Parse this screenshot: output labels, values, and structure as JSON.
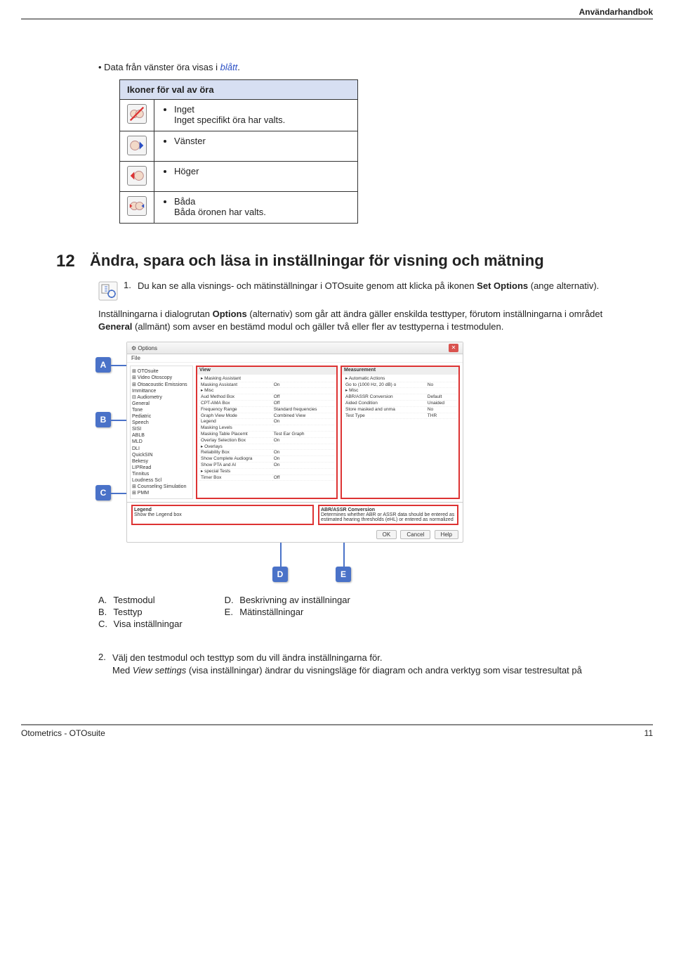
{
  "header": {
    "doc_label": "Användarhandbok"
  },
  "footer": {
    "left": "Otometrics - OTOsuite",
    "page": "11"
  },
  "intro_text_prefix": "Data från vänster öra visas i ",
  "intro_text_blue": "blått",
  "intro_text_suffix": ".",
  "ear_table": {
    "header": "Ikoner för val av öra",
    "rows": [
      {
        "icon": "none",
        "title": "Inget",
        "desc": "Inget specifikt öra har valts."
      },
      {
        "icon": "left",
        "title": "Vänster",
        "desc": ""
      },
      {
        "icon": "right",
        "title": "Höger",
        "desc": ""
      },
      {
        "icon": "both",
        "title": "Båda",
        "desc": "Båda öronen har valts."
      }
    ]
  },
  "section": {
    "num": "12",
    "title": "Ändra, spara och läsa in inställningar för visning och mätning"
  },
  "step1": {
    "num": "1.",
    "text_a": "Du kan se alla visnings- och mätinställningar i OTOsuite genom att klicka på ikonen ",
    "bold": "Set Options",
    "text_b": " (ange alternativ)."
  },
  "para2_a": "Inställningarna i dialogrutan ",
  "para2_bold1": "Options",
  "para2_b": " (alternativ) som går att ändra gäller enskilda testtyper, förutom inställningarna i området ",
  "para2_bold2": "General",
  "para2_c": " (allmänt) som avser en bestämd modul och gäller två eller fler av testtyperna i testmodulen.",
  "screenshot": {
    "title": "Options",
    "file_menu": "File",
    "tree": [
      "⊞ OTOsuite",
      "⊞ Video Otoscopy",
      "⊞ Otoacoustic Emissions",
      "  Immittance",
      "⊟ Audiometry",
      "    General",
      "    Tone",
      "    Pediatric",
      "    Speech",
      "    SISI",
      "    ABLB",
      "    MLD",
      "    DLI",
      "    QuickSIN",
      "    Bekesy",
      "    LIPRead",
      "    Tinnitus",
      "    Loudness Scl",
      "⊞ Counseling Simulation",
      "⊞ PMM"
    ],
    "view_head": "View",
    "view_rows": [
      [
        "▸ Masking Assistant",
        ""
      ],
      [
        "  Masking Assistant",
        "On"
      ],
      [
        "▸ Misc",
        ""
      ],
      [
        "  Aud Method Box",
        "Off"
      ],
      [
        "  CPT-AMA Box",
        "Off"
      ],
      [
        "  Frequency Range",
        "Standard frequencies"
      ],
      [
        "  Graph View Mode",
        "Combined View"
      ],
      [
        "  Legend",
        "On"
      ],
      [
        "  Masking Levels",
        ""
      ],
      [
        "  Masking Table Placemt",
        "Test Ear Graph"
      ],
      [
        "  Overlay Selection Box",
        "On"
      ],
      [
        "▸ Overlays",
        ""
      ],
      [
        "  Reliability Box",
        "On"
      ],
      [
        "  Show Complete Audiogra",
        "On"
      ],
      [
        "  Show PTA and AI",
        "On"
      ],
      [
        "▸ special Tests",
        ""
      ],
      [
        "  Timer Box",
        "Off"
      ]
    ],
    "meas_head": "Measurement",
    "meas_rows": [
      [
        "▸ Automatic Actions",
        ""
      ],
      [
        "  Go to (1000 Hz, 20 dB) o",
        "No"
      ],
      [
        "▸ Misc",
        ""
      ],
      [
        "  ABR/ASSR Conversion",
        "Default"
      ],
      [
        "  Aided Condition",
        "Unaided"
      ],
      [
        "  Store masked and unma",
        "No"
      ],
      [
        "  Test Type",
        "THR"
      ]
    ],
    "legend_left_head": "Legend",
    "legend_left_body": "Show the Legend box",
    "legend_right_head": "ABR/ASSR Conversion",
    "legend_right_body": "Determines whether ABR or ASSR data should be entered as estimated hearing thresholds (eHL) or entered as normalized",
    "buttons": {
      "ok": "OK",
      "cancel": "Cancel",
      "help": "Help"
    },
    "callouts": {
      "A": "A",
      "B": "B",
      "C": "C",
      "D": "D",
      "E": "E"
    }
  },
  "legend": {
    "left": [
      {
        "l": "A.",
        "t": "Testmodul"
      },
      {
        "l": "B.",
        "t": "Testtyp"
      },
      {
        "l": "C.",
        "t": "Visa inställningar"
      }
    ],
    "right": [
      {
        "l": "D.",
        "t": "Beskrivning av inställningar"
      },
      {
        "l": "E.",
        "t": "Mätinställningar"
      }
    ]
  },
  "step2": {
    "num": "2.",
    "line1": "Välj den testmodul och testtyp som du vill ändra inställningarna för.",
    "line2_a": "Med ",
    "line2_ital": "View settings",
    "line2_b": " (visa inställningar) ändrar du visningsläge för diagram och andra verktyg som visar testresultat på"
  }
}
